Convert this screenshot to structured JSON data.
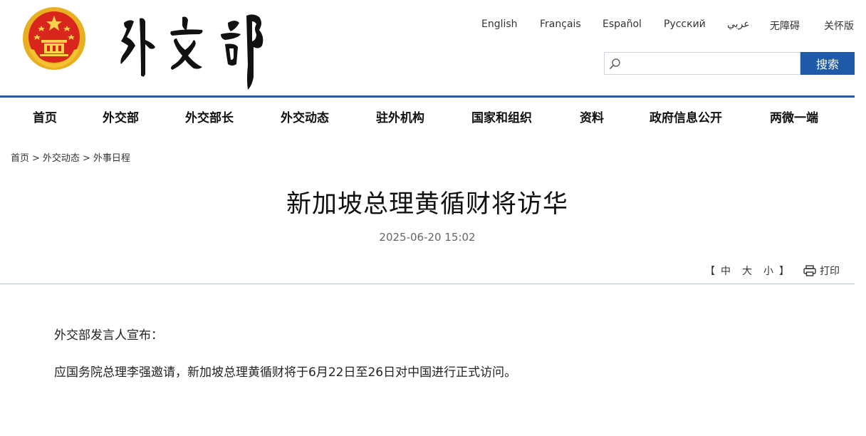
{
  "header": {
    "logo_text": "外交部",
    "languages": [
      "English",
      "Français",
      "Español",
      "Русский",
      "عربي",
      "无障碍",
      "关怀版"
    ],
    "search": {
      "placeholder": "",
      "button_label": "搜索"
    }
  },
  "nav": {
    "items": [
      "首页",
      "外交部",
      "外交部长",
      "外交动态",
      "驻外机构",
      "国家和组织",
      "资料",
      "政府信息公开",
      "两微一端"
    ]
  },
  "breadcrumb": {
    "items": [
      "首页",
      "外交动态",
      "外事日程"
    ],
    "separator": ">"
  },
  "article": {
    "title": "新加坡总理黄循财将访华",
    "date": "2025-06-20 15:02",
    "font_size": {
      "open": "【",
      "large": "中",
      "medium": "大",
      "small": "小",
      "close": "】"
    },
    "print_label": "打印",
    "paragraphs": [
      "外交部发言人宣布：",
      "应国务院总理李强邀请，新加坡总理黄循财将于6月22日至26日对中国进行正式访问。"
    ]
  },
  "colors": {
    "brand_blue": "#1d5ea8",
    "search_button": "#1e5aa8",
    "emblem_red": "#d9261c",
    "emblem_gold": "#f2c230"
  }
}
